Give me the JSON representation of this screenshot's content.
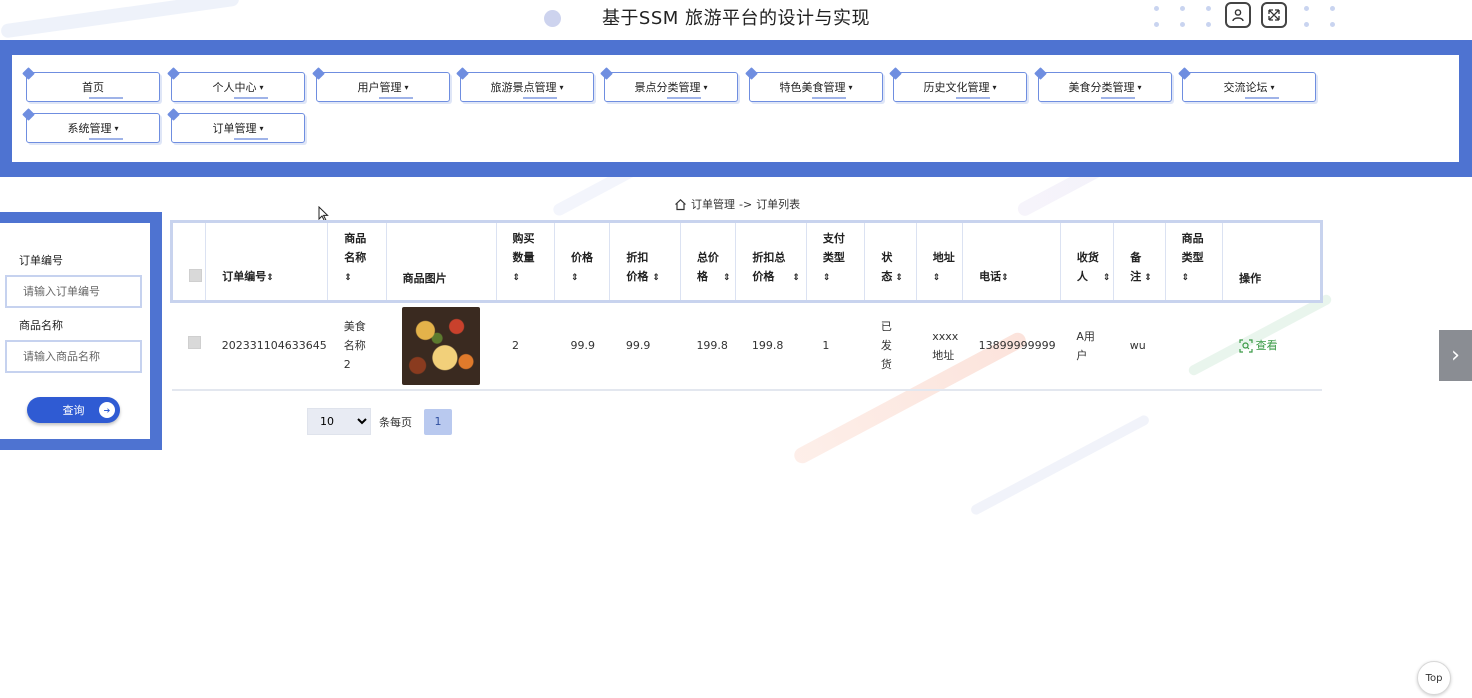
{
  "header": {
    "title": "基于SSM 旅游平台的设计与实现",
    "icons": [
      "user-icon",
      "fullscreen-icon"
    ]
  },
  "nav": {
    "items": [
      {
        "label": "首页",
        "caret": ""
      },
      {
        "label": "个人中心",
        "caret": "▾"
      },
      {
        "label": "用户管理",
        "caret": "▾"
      },
      {
        "label": "旅游景点管理",
        "caret": "▾"
      },
      {
        "label": "景点分类管理",
        "caret": "▾"
      },
      {
        "label": "特色美食管理",
        "caret": "▾"
      },
      {
        "label": "历史文化管理",
        "caret": "▾"
      },
      {
        "label": "美食分类管理",
        "caret": "▾"
      },
      {
        "label": "交流论坛",
        "caret": "▾"
      },
      {
        "label": "系统管理",
        "caret": "▾"
      },
      {
        "label": "订单管理",
        "caret": "▾"
      }
    ]
  },
  "breadcrumb": {
    "parent": "订单管理",
    "separator": "->",
    "current": "订单列表"
  },
  "search": {
    "order_no_label": "订单编号",
    "order_no_placeholder": "请输入订单编号",
    "product_name_label": "商品名称",
    "product_name_placeholder": "请输入商品名称",
    "button_label": "查询"
  },
  "table": {
    "columns": [
      {
        "label": "订单编号",
        "sort": "⇕"
      },
      {
        "label": "商品名称",
        "sort": "⇕"
      },
      {
        "label": "商品图片",
        "sort": ""
      },
      {
        "label": "购买数量",
        "sort": "⇕"
      },
      {
        "label": "价格",
        "sort": "⇕"
      },
      {
        "label": "折扣价格",
        "sort": "⇕"
      },
      {
        "label": "总价格",
        "sort": "⇕"
      },
      {
        "label": "折扣总价格",
        "sort": "⇕"
      },
      {
        "label": "支付类型",
        "sort": "⇕"
      },
      {
        "label": "状态",
        "sort": "⇕"
      },
      {
        "label": "地址",
        "sort": "⇕"
      },
      {
        "label": "电话",
        "sort": "⇕"
      },
      {
        "label": "收货人",
        "sort": "⇕"
      },
      {
        "label": "备注",
        "sort": "⇕"
      },
      {
        "label": "商品类型",
        "sort": "⇕"
      },
      {
        "label": "操作",
        "sort": ""
      }
    ],
    "rows": [
      {
        "order_no": "202331104633645",
        "product_name": "美食名称2",
        "quantity": "2",
        "price": "99.9",
        "discount_price": "99.9",
        "total_price": "199.8",
        "discount_total": "199.8",
        "pay_type": "1",
        "status": "已发货",
        "address": "xxxx地址",
        "phone": "13899999999",
        "receiver": "A用户",
        "remark": "wu",
        "product_type": "",
        "action": "查看"
      }
    ]
  },
  "pagination": {
    "page_size": "10",
    "per_page_label": "条每页",
    "current_page": "1"
  },
  "misc": {
    "top_label": "Top",
    "next_arrow": "›"
  }
}
